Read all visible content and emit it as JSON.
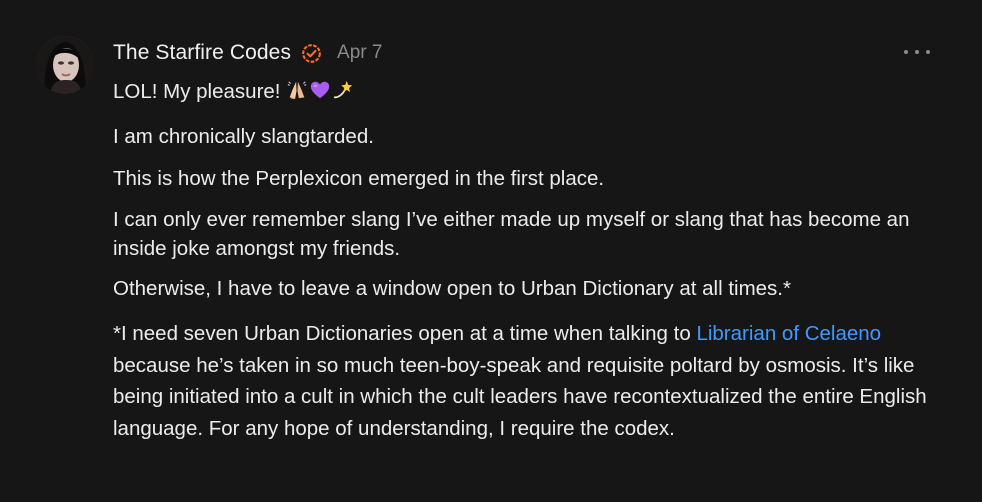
{
  "comment": {
    "author": "The Starfire Codes",
    "date": "Apr 7",
    "avatar_icon": "profile-photo",
    "verified_icon": "verified-badge-icon",
    "verified_color": "#ff6a2a",
    "more_icon": "more-options-icon",
    "paragraphs": {
      "p1_text": "LOL! My pleasure!",
      "p1_emojis": [
        "folded-hands-icon",
        "purple-heart-icon",
        "dizzy-star-icon"
      ],
      "p2": "I am chronically slangtarded.",
      "p3": "This is how the Perplexicon emerged in the first place.",
      "p4": "I can only ever remember slang I’ve either made up myself or slang that has become an inside joke amongst my friends.",
      "p5": "Otherwise, I have to leave a window open to Urban Dictionary at all times.*",
      "p6_before": "*I need seven Urban Dictionaries open at a time when talking to ",
      "p6_link": "Librarian of Celaeno",
      "p6_after": " because he’s taken in so much teen-boy-speak and requisite poltard by osmosis. It’s like being initiated into a cult in which the cult leaders have recontextualized the entire English language. For any hope of understanding, I require the codex."
    }
  },
  "colors": {
    "background": "#161616",
    "text": "#ececec",
    "muted": "#8a8a8a",
    "link": "#3d9bff"
  }
}
